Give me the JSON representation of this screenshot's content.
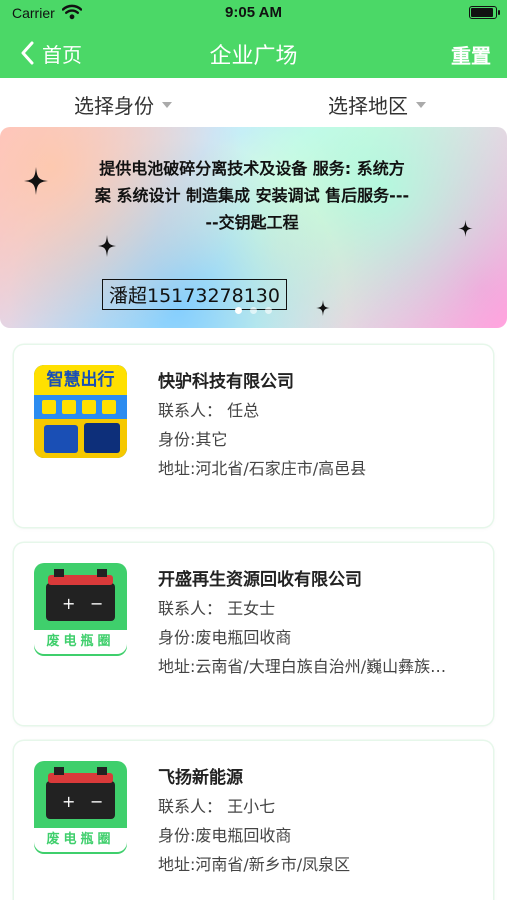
{
  "status_bar": {
    "carrier": "Carrier",
    "time": "9:05 AM",
    "battery_level": 0.95
  },
  "nav": {
    "back_label": "首页",
    "title": "企业广场",
    "reset_label": "重置"
  },
  "filters": {
    "identity": "选择身份",
    "region": "选择地区"
  },
  "banner": {
    "text": "提供电池破碎分离技术及设备 服务: 系统方案 系统设计 制造集成 安装调试 售后服务-----交钥匙工程",
    "contact": "潘超15173278130",
    "slide_count": 3,
    "active_slide": 1
  },
  "companies": [
    {
      "name": "快驴科技有限公司",
      "contact": "联系人：  任总",
      "identity": "身份:其它",
      "address": "地址:河北省/石家庄市/高邑县",
      "logo": "advertisement-logo",
      "logo_text": "智慧出行"
    },
    {
      "name": "开盛再生资源回收有限公司",
      "contact": "联系人：  王女士",
      "identity": "身份:废电瓶回收商",
      "address": "地址:云南省/大理白族自治州/巍山彝族…",
      "logo": "battery-logo",
      "logo_text": "废电瓶圈"
    },
    {
      "name": "飞扬新能源",
      "contact": "联系人：  王小七",
      "identity": "身份:废电瓶回收商",
      "address": "地址:河南省/新乡市/凤泉区",
      "logo": "battery-logo",
      "logo_text": "废电瓶圈"
    }
  ],
  "colors": {
    "primary": "#4bd867",
    "logo_green": "#3fcf6c"
  }
}
